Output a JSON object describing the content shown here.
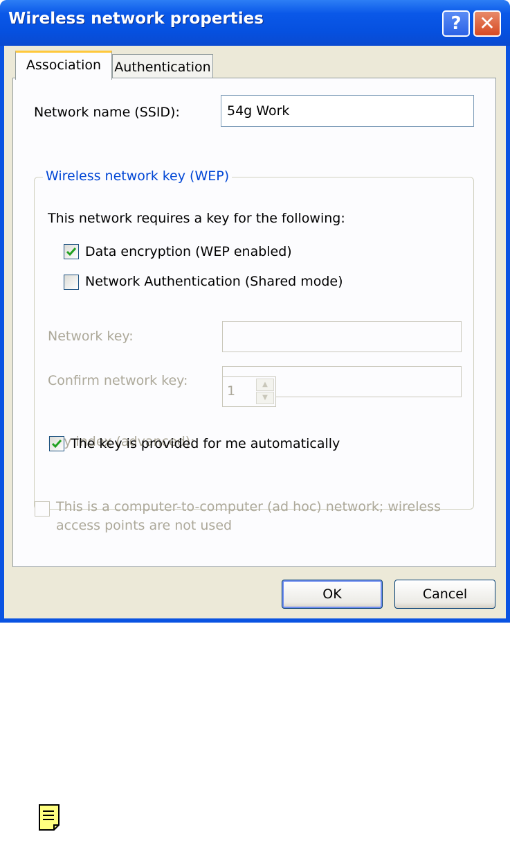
{
  "window": {
    "title": "Wireless network properties",
    "help_button": "?",
    "close_button": "✕"
  },
  "tabs": [
    {
      "label": "Association",
      "active": true
    },
    {
      "label": "Authentication",
      "active": false
    }
  ],
  "ssid": {
    "label": "Network name (SSID):",
    "value": "54g Work"
  },
  "wep_group": {
    "legend": "Wireless network key (WEP)",
    "intro": "This network requires a key for the following:",
    "data_encryption": {
      "label": "Data encryption (WEP enabled)",
      "checked": true
    },
    "network_auth": {
      "label": "Network Authentication (Shared mode)",
      "checked": false
    },
    "network_key": {
      "label": "Network key:",
      "value": ""
    },
    "confirm_key": {
      "label": "Confirm network key:",
      "value": ""
    },
    "key_index": {
      "label": "Key index (advanced):",
      "value": "1"
    },
    "auto_key": {
      "label": "The key is provided for me automatically",
      "checked": true
    }
  },
  "adhoc": {
    "label_line1": "This is a computer-to-computer (ad hoc) network; wireless",
    "label_line2": "access points are not used",
    "checked": false
  },
  "buttons": {
    "ok": "OK",
    "cancel": "Cancel"
  },
  "colors": {
    "titlebar": "#0a58e8",
    "dialog_face": "#ece9d8",
    "group_legend": "#0046d5",
    "disabled_text": "#aca899",
    "checkmark": "#21a121"
  },
  "icons": {
    "note": "note-icon"
  }
}
